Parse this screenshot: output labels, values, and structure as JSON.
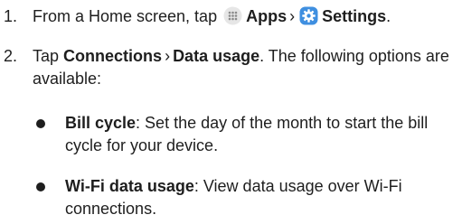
{
  "steps": [
    {
      "number": "1.",
      "text_before": "From a Home screen, tap",
      "apps_icon": "apps-grid-icon",
      "apps_label": "Apps",
      "separator": "›",
      "settings_icon": "settings-gear-icon",
      "settings_label": "Settings",
      "text_after": "."
    },
    {
      "number": "2.",
      "text_before": "Tap",
      "connections_label": "Connections",
      "separator": "›",
      "data_usage_label": "Data usage",
      "text_after": ". The following options are available:"
    }
  ],
  "options": [
    {
      "title": "Bill cycle",
      "description": ": Set the day of the month to start the bill cycle for your device."
    },
    {
      "title": "Wi-Fi data usage",
      "description": ": View data usage over Wi-Fi connections."
    }
  ],
  "colors": {
    "text": "#1e1e1e",
    "apps_icon_bg": "#e6e6e6",
    "settings_icon_bg": "#3f8fe0"
  }
}
